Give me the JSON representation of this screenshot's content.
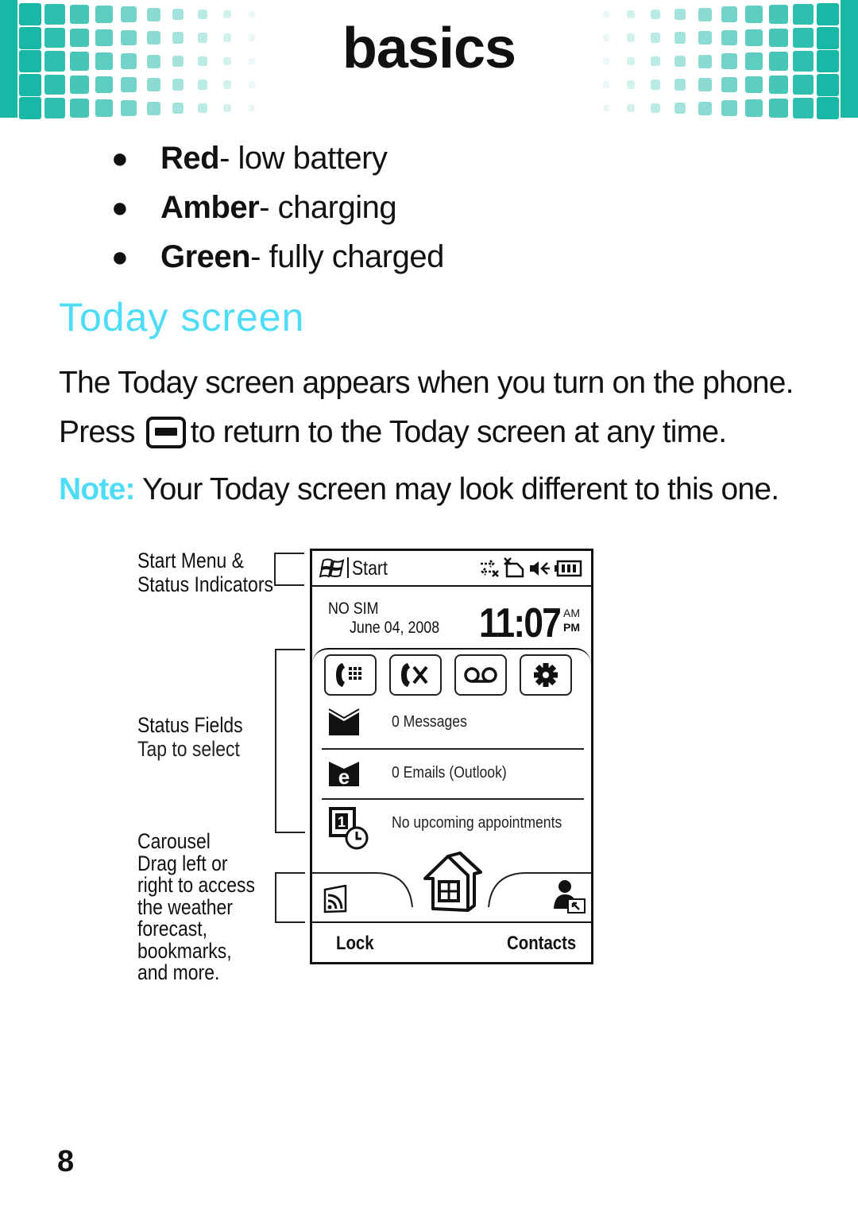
{
  "header": {
    "title": "basics",
    "accent_color": "#19b8a6"
  },
  "battery_legend": [
    {
      "color_name": "Red",
      "meaning": " - low battery"
    },
    {
      "color_name": "Amber",
      "meaning": " - charging"
    },
    {
      "color_name": "Green",
      "meaning": " - fully charged"
    }
  ],
  "section": {
    "title": "Today screen",
    "title_color": "#4fdcf7",
    "paragraph1": "The Today screen appears when you turn on the phone.",
    "paragraph2_before": "Press",
    "paragraph2_icon": "home-key-icon",
    "paragraph2_after": "to return to the Today screen at any time.",
    "note_label": "Note:",
    "note_text": " Your Today screen may look different to this one."
  },
  "callouts": {
    "start_menu": [
      "Start Menu &",
      "Status Indicators"
    ],
    "status_fields_title": "Status Fields",
    "status_fields_sub": "Tap to select",
    "carousel_title": "Carousel",
    "carousel_lines": [
      "Drag left or",
      "right to access",
      "the weather",
      "forecast,",
      "bookmarks,",
      "and more."
    ]
  },
  "phone": {
    "start_label": "Start",
    "status_icons": [
      "data-connection-off-icon",
      "no-sim-icon",
      "vibrate-icon",
      "battery-icon"
    ],
    "sim_status": "NO SIM",
    "date": "June 04, 2008",
    "time": "11:07",
    "am": "AM",
    "pm": "PM",
    "quick_buttons": [
      "dialer-icon",
      "missed-call-icon",
      "voicemail-icon",
      "settings-icon"
    ],
    "status_rows": [
      {
        "icon": "message-icon",
        "label": "0 Messages"
      },
      {
        "icon": "email-icon",
        "label": "0 Emails (Outlook)"
      },
      {
        "icon": "calendar-icon",
        "label": "No upcoming appointments"
      }
    ],
    "carousel_items": [
      "rss-icon",
      "home-icon",
      "contacts-icon"
    ],
    "softkey_left": "Lock",
    "softkey_right": "Contacts"
  },
  "page_number": "8"
}
